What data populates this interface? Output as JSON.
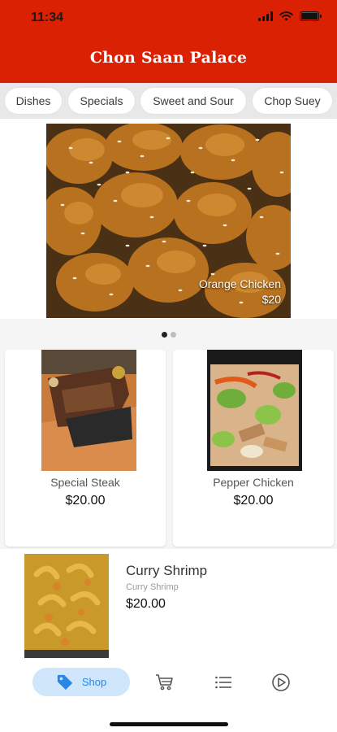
{
  "status_bar": {
    "time": "11:34"
  },
  "header": {
    "title": "Chon Saan Palace",
    "color": "#db2104"
  },
  "categories": [
    {
      "label": "Dishes"
    },
    {
      "label": "Specials"
    },
    {
      "label": "Sweet and Sour"
    },
    {
      "label": "Chop Suey"
    }
  ],
  "featured": {
    "name": "Orange Chicken",
    "price": "$20",
    "pager": {
      "count": 2,
      "active": 1
    }
  },
  "cards": [
    {
      "name": "Special Steak",
      "price": "$20.00"
    },
    {
      "name": "Pepper Chicken",
      "price": "$20.00"
    }
  ],
  "list_item": {
    "title": "Curry Shrimp",
    "subtitle": "Curry Shrimp",
    "price": "$20.00"
  },
  "bottom_nav": {
    "active_label": "Shop",
    "active_color": "#2a86e6",
    "items": [
      {
        "icon": "tag-icon",
        "label": "Shop"
      },
      {
        "icon": "cart-icon"
      },
      {
        "icon": "list-icon"
      },
      {
        "icon": "play-circle-icon"
      }
    ]
  }
}
